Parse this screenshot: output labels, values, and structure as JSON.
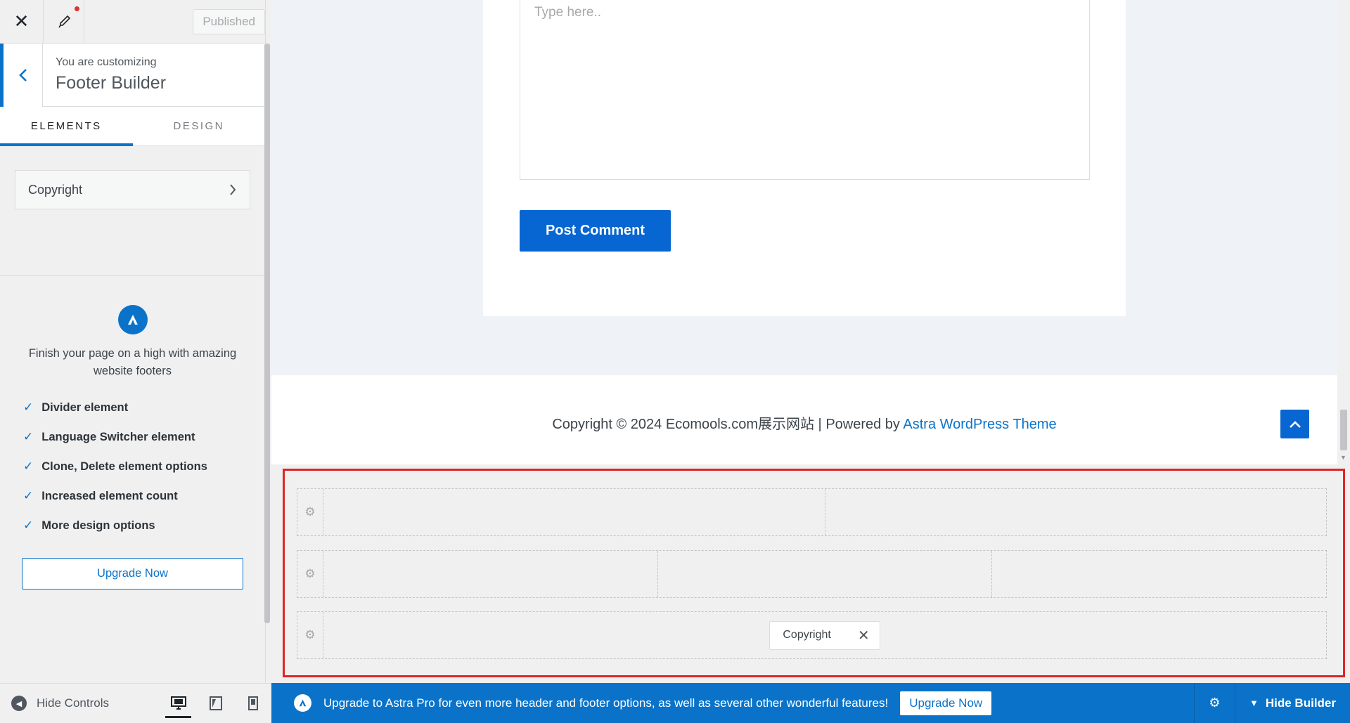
{
  "sidebar": {
    "published_label": "Published",
    "customizing_small": "You are customizing",
    "customizing_title": "Footer Builder",
    "tabs": [
      {
        "label": "ELEMENTS",
        "active": true
      },
      {
        "label": "DESIGN",
        "active": false
      }
    ],
    "element_item": "Copyright",
    "promo_text": "Finish your page on a high with amazing website footers",
    "features": [
      "Divider element",
      "Language Switcher element",
      "Clone, Delete element options",
      "Increased element count",
      "More design options"
    ],
    "upgrade_label": "Upgrade Now",
    "hide_controls_label": "Hide Controls"
  },
  "preview": {
    "comment_placeholder": "Type here..",
    "post_comment_label": "Post Comment",
    "footer_prefix": "Copyright © 2024 Ecomools.com展示网站 | Powered by ",
    "footer_link": "Astra WordPress Theme",
    "builder_chip": "Copyright"
  },
  "promo_bar": {
    "message": "Upgrade to Astra Pro for even more header and footer options, as well as several other wonderful features!",
    "upgrade_label": "Upgrade Now",
    "hide_builder_label": "Hide Builder"
  },
  "colors": {
    "accent": "#0a73c9",
    "button_blue": "#0766d1",
    "highlight_red": "#e02424"
  },
  "icons": [
    "close-icon",
    "brush-icon",
    "chevron-left-icon",
    "chevron-right-icon",
    "astra-logo-icon",
    "check-icon",
    "circle-left-icon",
    "desktop-icon",
    "tablet-icon",
    "mobile-icon",
    "arrow-up-icon",
    "gear-icon",
    "chevron-down-icon"
  ]
}
